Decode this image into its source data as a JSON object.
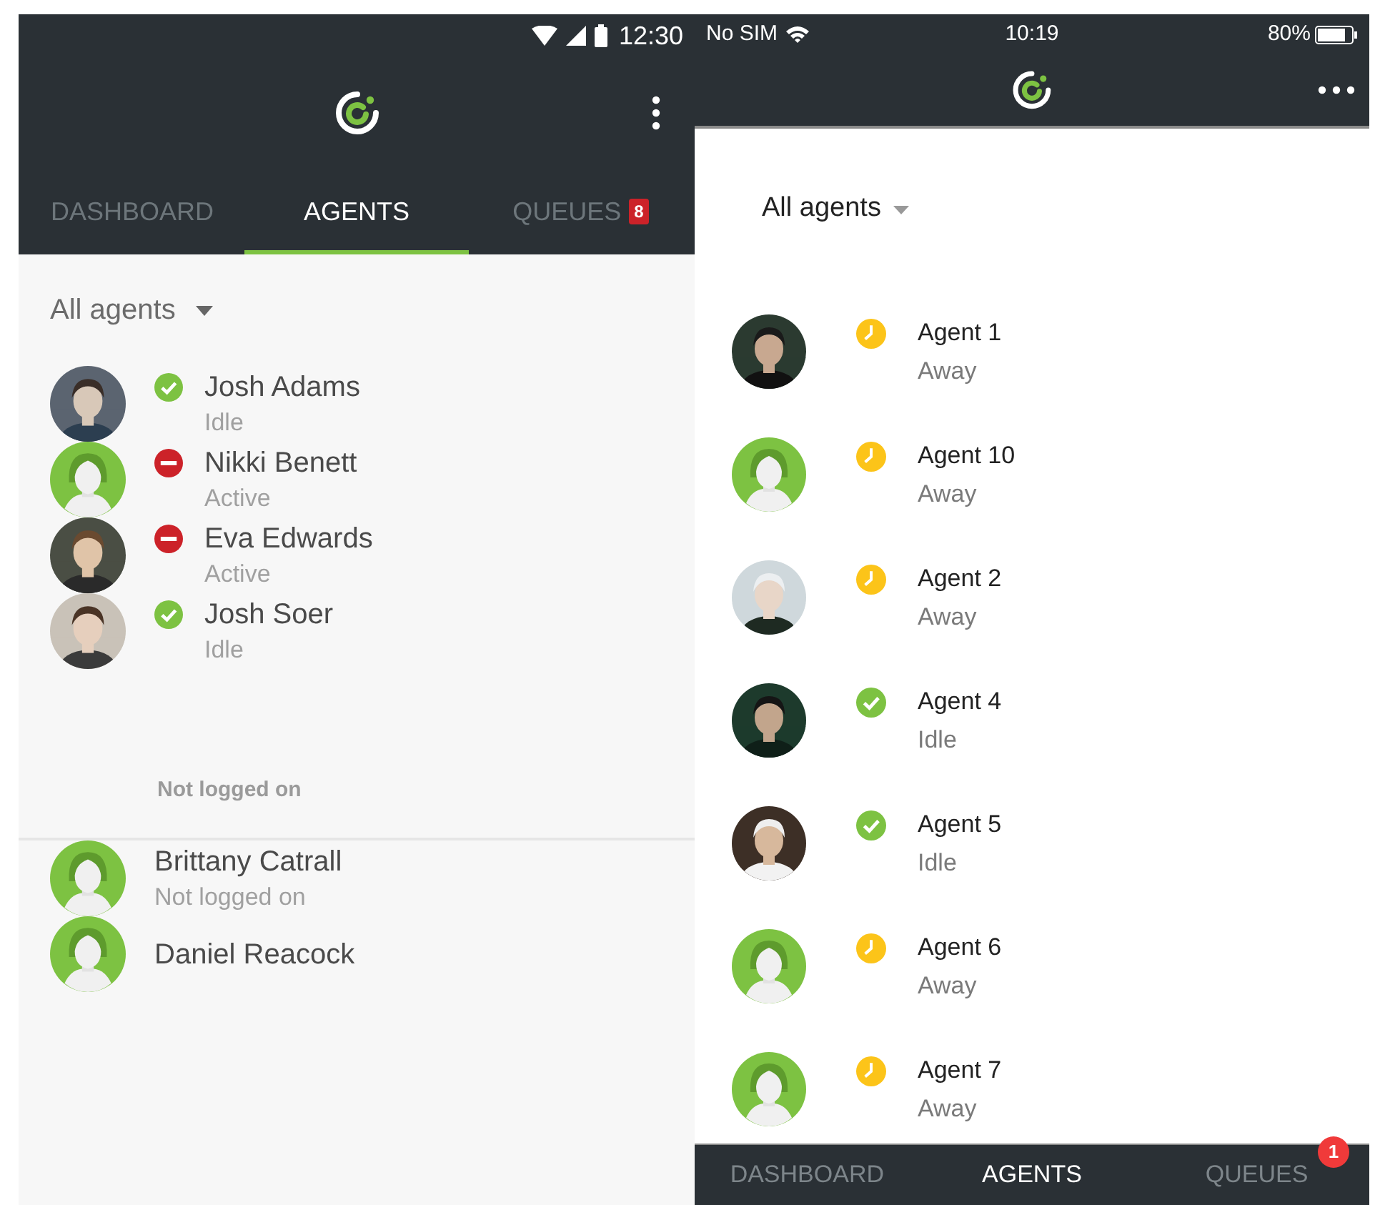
{
  "left_screen": {
    "status_bar": {
      "time": "12:30"
    },
    "tabs": [
      {
        "label": "DASHBOARD",
        "selected": false
      },
      {
        "label": "AGENTS",
        "selected": true
      },
      {
        "label": "QUEUES",
        "selected": false,
        "badge": "8"
      }
    ],
    "filter": "All agents",
    "agents": [
      {
        "name": "Josh Adams",
        "status": "Idle",
        "kind": "idle"
      },
      {
        "name": "Nikki Benett",
        "status": "Active",
        "kind": "active",
        "avatar": {
          "kind": "default"
        }
      },
      {
        "name": "Eva Edwards",
        "status": "Active",
        "kind": "active"
      },
      {
        "name": "Josh Soer",
        "status": "Idle",
        "kind": "idle"
      }
    ],
    "section_header": "Not logged on",
    "offline_agents": [
      {
        "name": "Brittany Catrall",
        "status": "Not logged on",
        "avatar": {
          "kind": "default"
        }
      },
      {
        "name": "Daniel Reacock",
        "avatar": {
          "kind": "default"
        }
      }
    ]
  },
  "right_screen": {
    "status_bar": {
      "carrier": "No SIM",
      "time": "10:19",
      "battery": "80%"
    },
    "filter": "All agents",
    "agents": [
      {
        "name": "Agent 1",
        "status": "Away",
        "kind": "away"
      },
      {
        "name": "Agent 10",
        "status": "Away",
        "kind": "away",
        "avatar": {
          "kind": "default"
        }
      },
      {
        "name": "Agent 2",
        "status": "Away",
        "kind": "away"
      },
      {
        "name": "Agent 4",
        "status": "Idle",
        "kind": "idle"
      },
      {
        "name": "Agent 5",
        "status": "Idle",
        "kind": "idle"
      },
      {
        "name": "Agent 6",
        "status": "Away",
        "kind": "away",
        "avatar": {
          "kind": "default"
        }
      },
      {
        "name": "Agent 7",
        "status": "Away",
        "kind": "away",
        "avatar": {
          "kind": "default"
        }
      }
    ],
    "tabs": [
      {
        "label": "DASHBOARD",
        "selected": false
      },
      {
        "label": "AGENTS",
        "selected": true
      },
      {
        "label": "QUEUES",
        "selected": false,
        "badge": "1"
      }
    ]
  }
}
